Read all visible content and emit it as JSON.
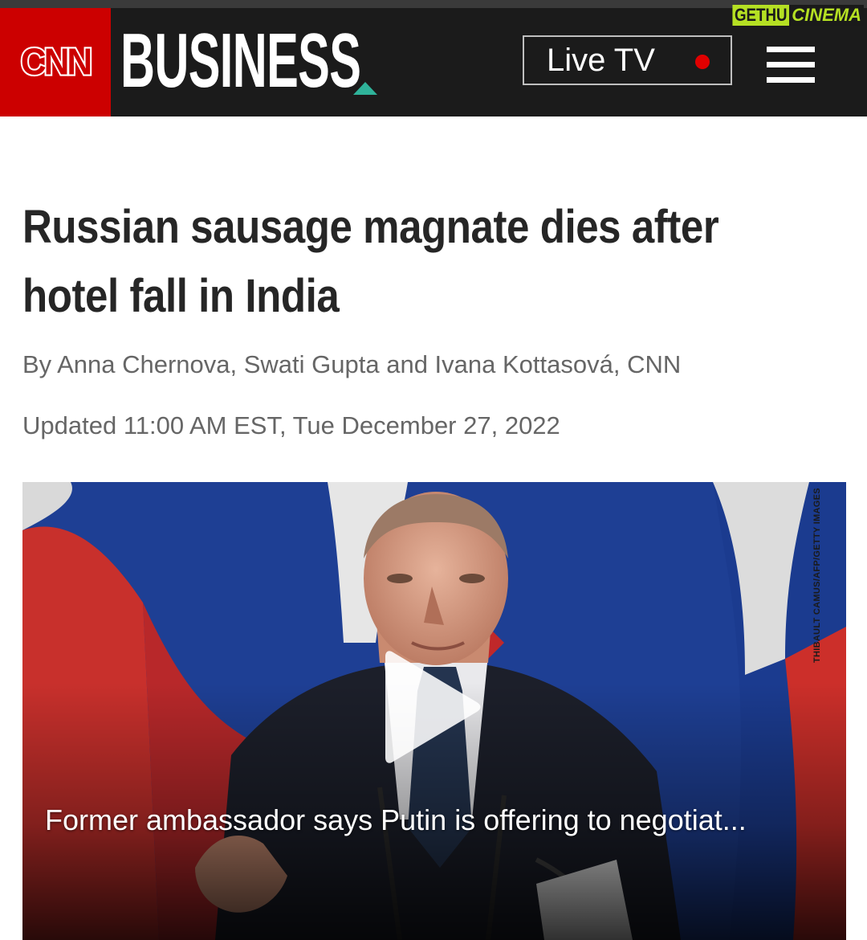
{
  "header": {
    "logo_text": "CNN",
    "section": "BUSINESS",
    "live_tv_label": "Live TV",
    "menu_icon": "hamburger-menu-icon",
    "brand_colors": {
      "cnn_red": "#cc0000",
      "header_bg": "#1b1b1b",
      "accent": "#2fb39a",
      "live_dot": "#e00000"
    }
  },
  "watermark": {
    "part1": "GETHU",
    "part2": "CINEMA"
  },
  "article": {
    "headline": "Russian sausage magnate dies after hotel fall in India",
    "byline": "By Anna Chernova, Swati Gupta and Ivana Kottasová, CNN",
    "updated": "Updated 11:00 AM EST, Tue December 27, 2022"
  },
  "video": {
    "caption": "Former ambassador says Putin is offering to negotiat...",
    "photo_credit": "THIBAULT CAMUS/AFP/GETTY IMAGES",
    "play_icon": "play-icon"
  }
}
